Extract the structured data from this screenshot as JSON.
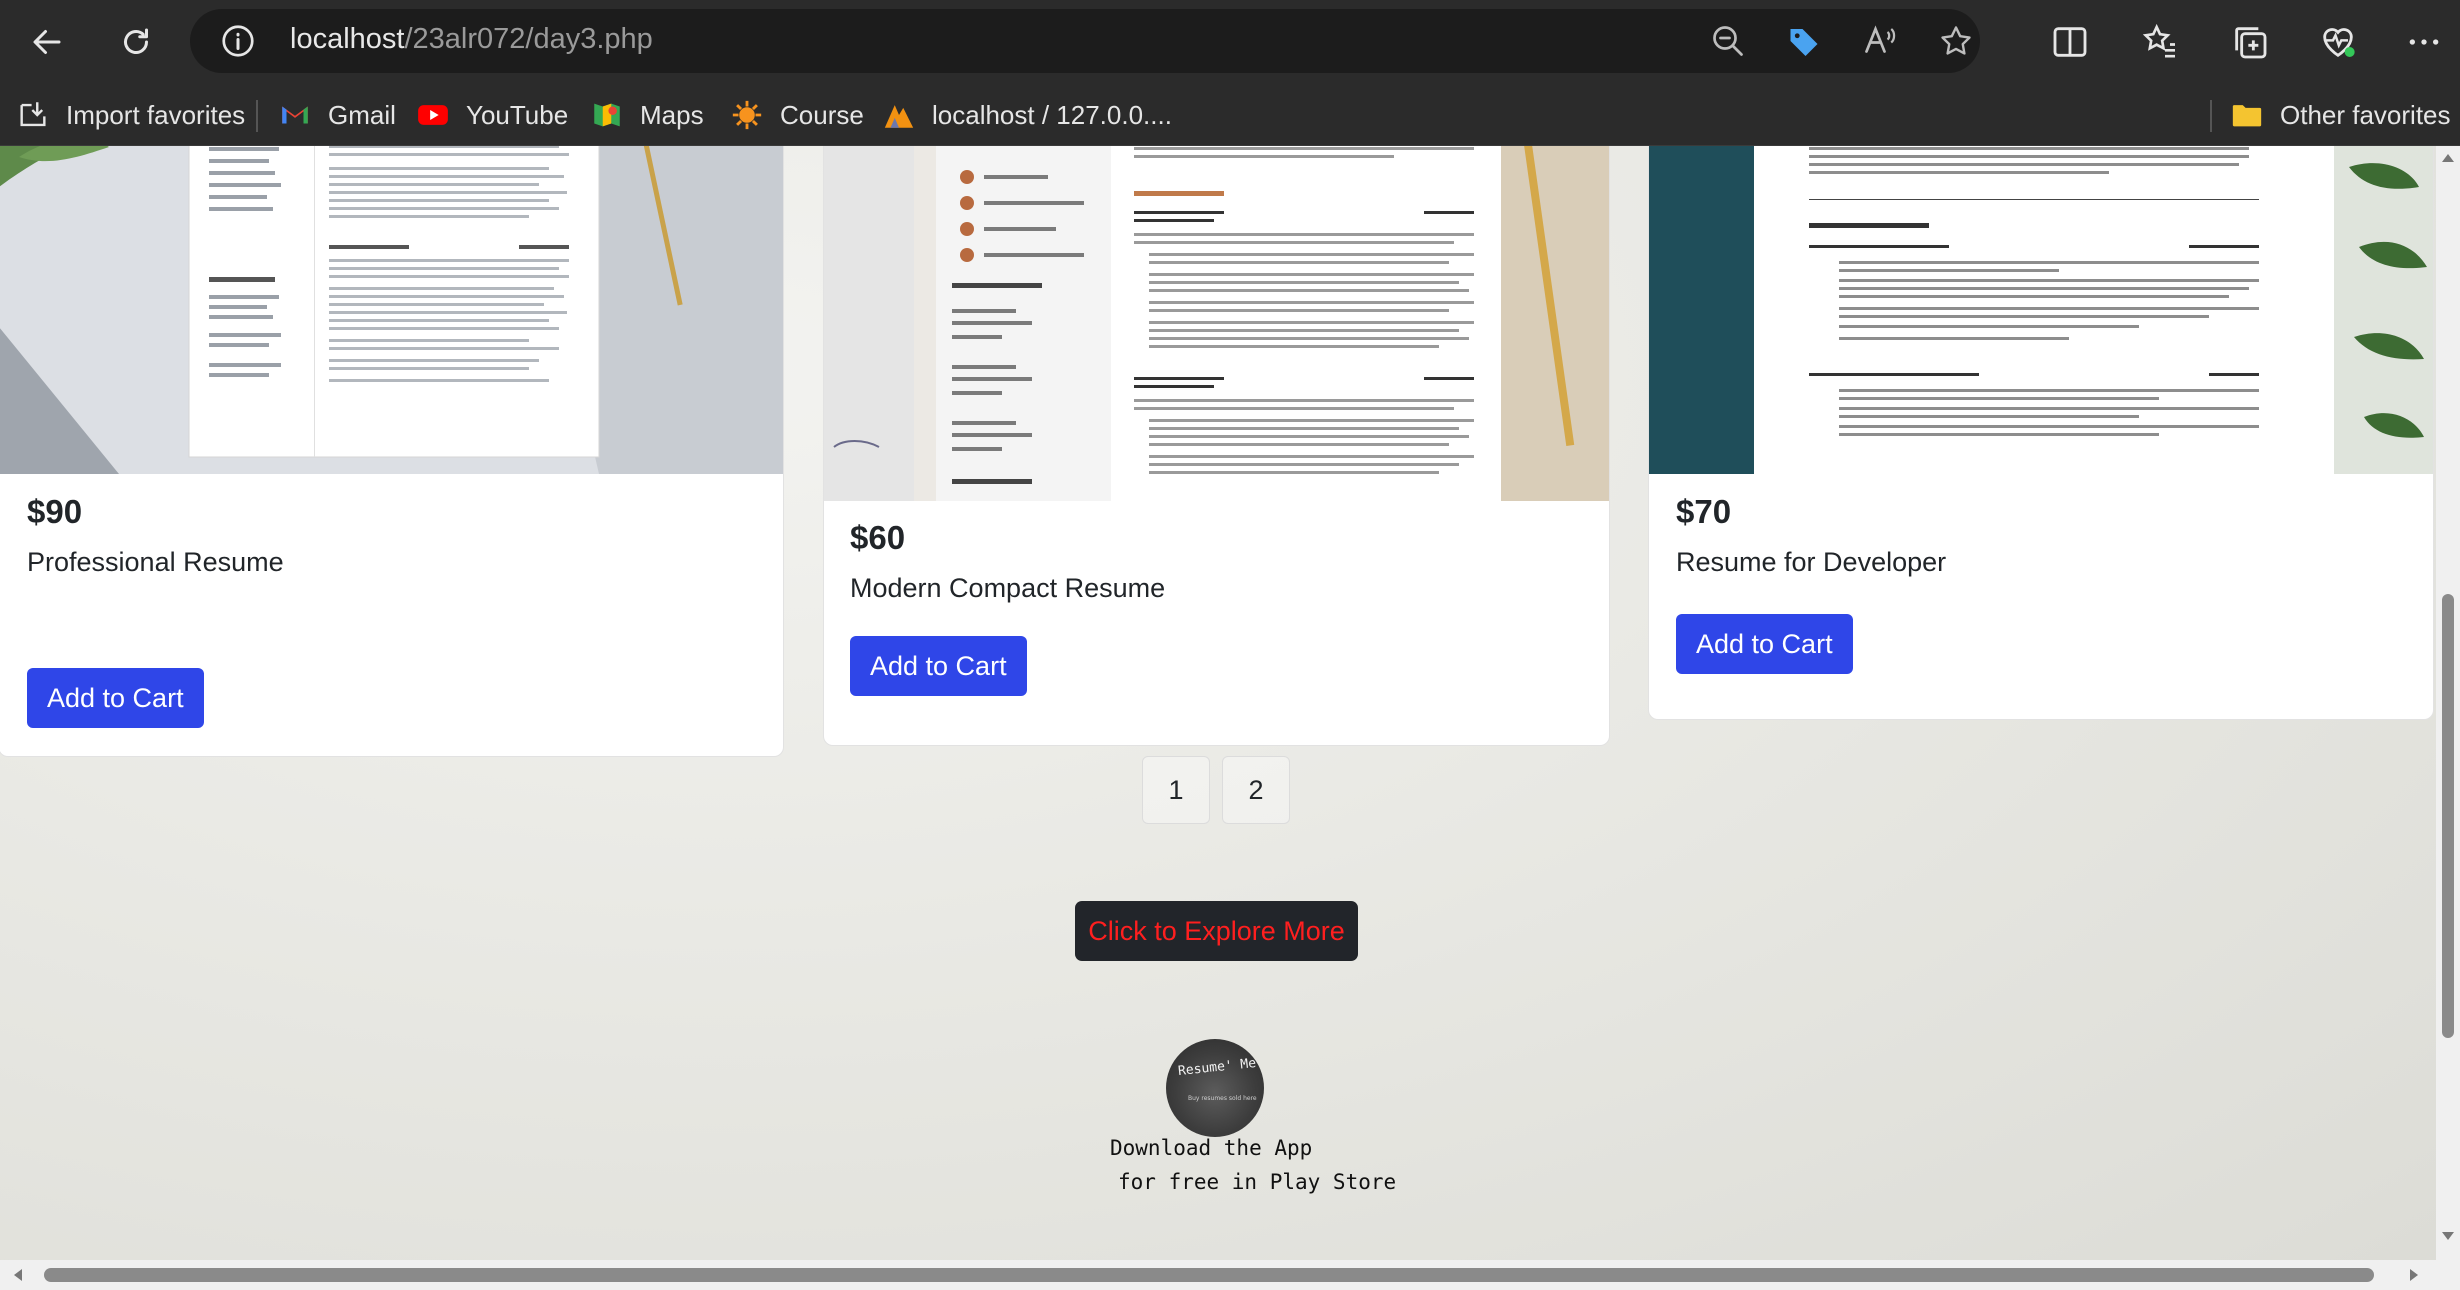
{
  "browser": {
    "url_host": "localhost",
    "url_path": "/23alr072/day3.php",
    "favorites": [
      {
        "label": "Import favorites",
        "icon": "import-favorites-icon"
      },
      {
        "label": "Gmail",
        "icon": "gmail-icon"
      },
      {
        "label": "YouTube",
        "icon": "youtube-icon"
      },
      {
        "label": "Maps",
        "icon": "maps-icon"
      },
      {
        "label": "Course",
        "icon": "course-icon"
      },
      {
        "label": "localhost / 127.0.0....",
        "icon": "phpmyadmin-icon"
      }
    ],
    "other_favorites": "Other favorites"
  },
  "products": [
    {
      "price": "$90",
      "name": "Professional Resume",
      "button": "Add to Cart"
    },
    {
      "price": "$60",
      "name": "Modern Compact Resume",
      "button": "Add to Cart"
    },
    {
      "price": "$70",
      "name": "Resume for Developer",
      "button": "Add to Cart"
    }
  ],
  "pagination": [
    "1",
    "2"
  ],
  "explore_button": "Click to Explore More",
  "footer": {
    "logo_text": "Resume' Me",
    "logo_subtext": "Buy resumes sold here",
    "download_line1": "Download the App",
    "download_line2": "for free in Play Store"
  },
  "colors": {
    "primary_button": "#2f46e8",
    "explore_text": "#ff1f1f",
    "explore_bg": "#22252a",
    "chrome_bg": "#2b2b2b"
  }
}
